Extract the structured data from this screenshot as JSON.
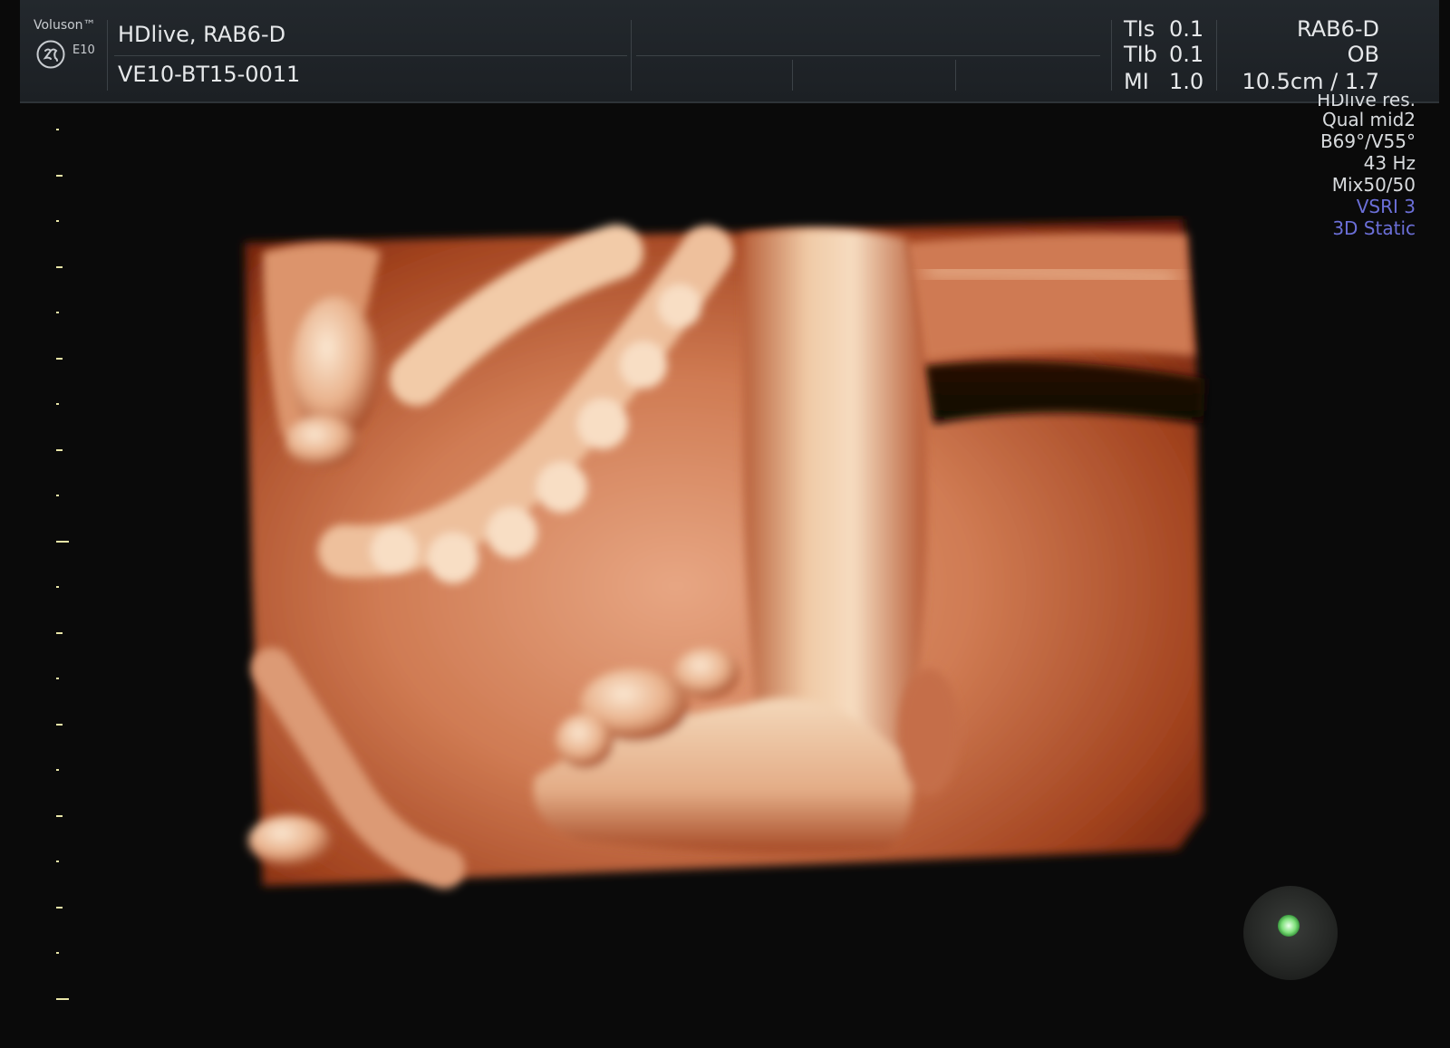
{
  "device": {
    "brand": "Voluson™",
    "model": "E10",
    "logo": "ge-logo-icon"
  },
  "header": {
    "preset": "HDlive, RAB6-D",
    "probe_id": "VE10-BT15-0011",
    "indices": [
      {
        "label": "TIs",
        "value": "0.1"
      },
      {
        "label": "TIb",
        "value": "0.1"
      },
      {
        "label": "MI",
        "value": "1.0"
      }
    ],
    "probe": "RAB6-D",
    "application": "OB",
    "depth": "10.5cm / 1.7"
  },
  "params": {
    "partial": "HDlive res.",
    "quality": "Qual mid2",
    "angles": "B69°/V55°",
    "frequency": "43 Hz",
    "mix": "Mix50/50",
    "vsri": "VSRI 3",
    "mode": "3D Static"
  },
  "scale": {
    "tick_color": "#e9e6a8",
    "major_every": 9
  },
  "render": {
    "subject": "3D HDlive rendering of fetal foot and hand",
    "skin_highlight": "#f3d6b4",
    "skin_mid": "#d98860",
    "skin_shadow": "#8a2a10"
  },
  "trackball": {
    "icon": "trackball-indicator-icon",
    "color": "#7ee07a"
  }
}
